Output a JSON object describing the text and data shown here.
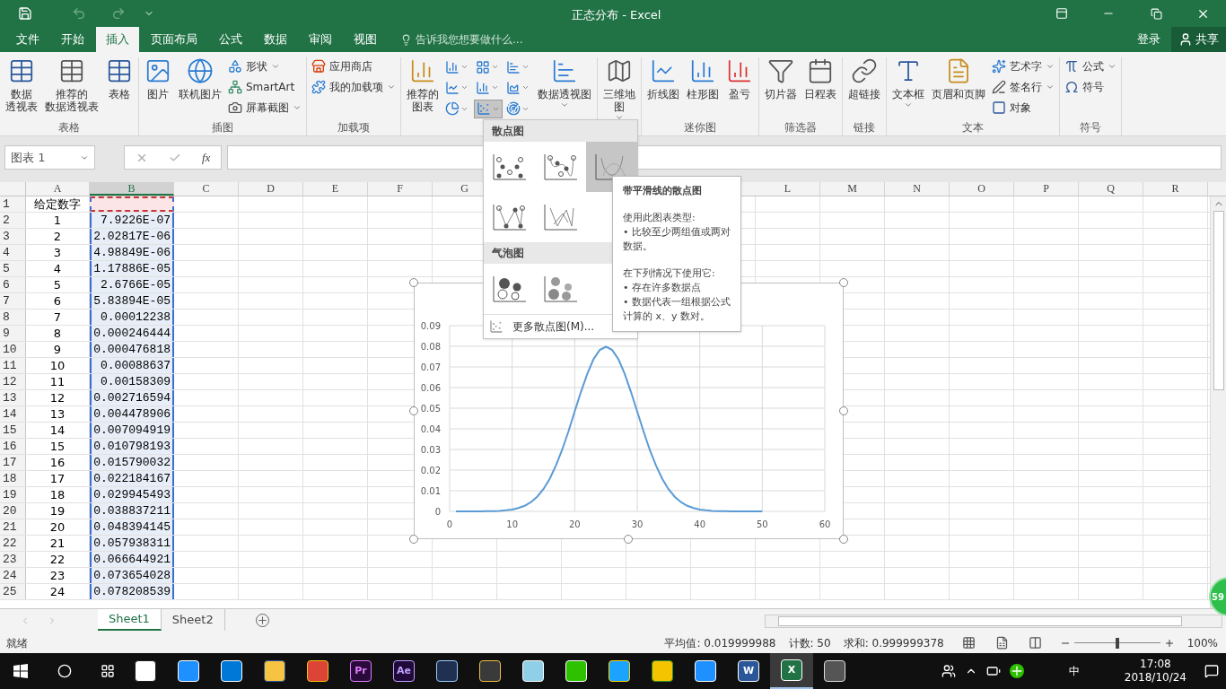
{
  "window": {
    "title": "正态分布 - Excel"
  },
  "tabs": [
    {
      "label": "文件",
      "selected": false
    },
    {
      "label": "开始",
      "selected": false
    },
    {
      "label": "插入",
      "selected": true
    },
    {
      "label": "页面布局",
      "selected": false
    },
    {
      "label": "公式",
      "selected": false
    },
    {
      "label": "数据",
      "selected": false
    },
    {
      "label": "审阅",
      "selected": false
    },
    {
      "label": "视图",
      "selected": false
    }
  ],
  "tell_me": {
    "placeholder": "告诉我您想要做什么..."
  },
  "account": {
    "sign_in": "登录",
    "share": "共享"
  },
  "ribbon": {
    "groups": [
      {
        "label": "表格",
        "items": [
          {
            "kind": "large",
            "lines": [
              "数据",
              "透视表"
            ],
            "dropdown": false
          },
          {
            "kind": "large",
            "lines": [
              "推荐的",
              "数据透视表"
            ],
            "dropdown": false
          },
          {
            "kind": "large",
            "lines": [
              "表格"
            ],
            "dropdown": false
          }
        ]
      },
      {
        "label": "插图",
        "items": [
          {
            "kind": "large",
            "lines": [
              "图片"
            ],
            "dropdown": false
          },
          {
            "kind": "large",
            "lines": [
              "联机图片"
            ],
            "dropdown": false
          },
          {
            "kind": "stack",
            "items": [
              {
                "label": "形状",
                "dropdown": true
              },
              {
                "label": "SmartArt",
                "dropdown": false
              },
              {
                "label": "屏幕截图",
                "dropdown": true
              }
            ]
          }
        ]
      },
      {
        "label": "加载项",
        "items": [
          {
            "kind": "stack",
            "items": [
              {
                "label": "应用商店",
                "dropdown": false
              },
              {
                "label": "我的加载项",
                "dropdown": true
              }
            ]
          }
        ]
      },
      {
        "items": [
          {
            "kind": "large",
            "lines": [
              "推荐的",
              "图表"
            ],
            "dropdown": false
          },
          {
            "kind": "grid",
            "items": [
              {
                "selected": false
              },
              {
                "selected": false
              },
              {
                "selected": false
              },
              {
                "selected": false
              },
              {
                "selected": false
              },
              {
                "selected": false
              },
              {
                "selected": false
              },
              {
                "selected": true
              },
              {
                "selected": false
              }
            ]
          },
          {
            "kind": "large",
            "lines": [
              "数据透视图"
            ],
            "dropdown": true
          }
        ]
      },
      {
        "items": [
          {
            "kind": "large",
            "lines": [
              "三维地",
              "图"
            ],
            "dropdown": true
          }
        ]
      },
      {
        "label": "迷你图",
        "items": [
          {
            "kind": "large",
            "lines": [
              "折线图"
            ],
            "dropdown": false
          },
          {
            "kind": "large",
            "lines": [
              "柱形图"
            ],
            "dropdown": false
          },
          {
            "kind": "large",
            "lines": [
              "盈亏"
            ],
            "dropdown": false
          }
        ]
      },
      {
        "label": "筛选器",
        "items": [
          {
            "kind": "large",
            "lines": [
              "切片器"
            ],
            "dropdown": false
          },
          {
            "kind": "large",
            "lines": [
              "日程表"
            ],
            "dropdown": false
          }
        ]
      },
      {
        "label": "链接",
        "items": [
          {
            "kind": "large",
            "lines": [
              "超链接"
            ],
            "dropdown": false
          }
        ]
      },
      {
        "label": "文本",
        "items": [
          {
            "kind": "large",
            "lines": [
              "文本框"
            ],
            "dropdown": true
          },
          {
            "kind": "large",
            "lines": [
              "页眉和页脚"
            ],
            "dropdown": false
          },
          {
            "kind": "stack",
            "items": [
              {
                "label": "艺术字",
                "dropdown": true
              },
              {
                "label": "签名行",
                "dropdown": true
              },
              {
                "label": "对象",
                "dropdown": false
              }
            ]
          }
        ]
      },
      {
        "label": "符号",
        "items": [
          {
            "kind": "stack",
            "items": [
              {
                "label": "公式",
                "dropdown": true
              },
              {
                "label": "符号",
                "dropdown": false
              }
            ]
          }
        ]
      }
    ]
  },
  "formula_bar": {
    "name_box": "图表 1",
    "fx": "fx"
  },
  "sheet": {
    "columns": [
      {
        "label": "A",
        "selected": false
      },
      {
        "label": "B",
        "selected": true
      },
      {
        "label": "C",
        "selected": false
      },
      {
        "label": "D",
        "selected": false
      },
      {
        "label": "E",
        "selected": false
      },
      {
        "label": "F",
        "selected": false
      },
      {
        "label": "G",
        "selected": false
      }
    ],
    "columns_right": [
      {
        "label": "L",
        "selected": false
      },
      {
        "label": "M",
        "selected": false
      },
      {
        "label": "N",
        "selected": false
      },
      {
        "label": "O",
        "selected": false
      },
      {
        "label": "P",
        "selected": false
      },
      {
        "label": "Q",
        "selected": false
      },
      {
        "label": "R",
        "selected": false
      }
    ],
    "rows": [
      {
        "number": "1",
        "a": "给定数字",
        "referenced": true
      },
      {
        "number": "2",
        "a": "1",
        "b": "7.9226E-07",
        "referenced": false
      },
      {
        "number": "3",
        "a": "2",
        "b": "2.02817E-06",
        "referenced": false
      },
      {
        "number": "4",
        "a": "3",
        "b": "4.98849E-06",
        "referenced": false
      },
      {
        "number": "5",
        "a": "4",
        "b": "1.17886E-05",
        "referenced": false
      },
      {
        "number": "6",
        "a": "5",
        "b": "2.6766E-05",
        "referenced": false
      },
      {
        "number": "7",
        "a": "6",
        "b": "5.83894E-05",
        "referenced": false
      },
      {
        "number": "8",
        "a": "7",
        "b": "0.00012238",
        "referenced": false
      },
      {
        "number": "9",
        "a": "8",
        "b": "0.000246444",
        "referenced": false
      },
      {
        "number": "10",
        "a": "9",
        "b": "0.000476818",
        "referenced": false
      },
      {
        "number": "11",
        "a": "10",
        "b": "0.00088637",
        "referenced": false
      },
      {
        "number": "12",
        "a": "11",
        "b": "0.00158309",
        "referenced": false
      },
      {
        "number": "13",
        "a": "12",
        "b": "0.002716594",
        "referenced": false
      },
      {
        "number": "14",
        "a": "13",
        "b": "0.004478906",
        "referenced": false
      },
      {
        "number": "15",
        "a": "14",
        "b": "0.007094919",
        "referenced": false
      },
      {
        "number": "16",
        "a": "15",
        "b": "0.010798193",
        "referenced": false
      },
      {
        "number": "17",
        "a": "16",
        "b": "0.015790032",
        "referenced": false
      },
      {
        "number": "18",
        "a": "17",
        "b": "0.022184167",
        "referenced": false
      },
      {
        "number": "19",
        "a": "18",
        "b": "0.029945493",
        "referenced": false
      },
      {
        "number": "20",
        "a": "19",
        "b": "0.038837211",
        "referenced": false
      },
      {
        "number": "21",
        "a": "20",
        "b": "0.048394145",
        "referenced": false
      },
      {
        "number": "22",
        "a": "21",
        "b": "0.057938311",
        "referenced": false
      },
      {
        "number": "23",
        "a": "22",
        "b": "0.066644921",
        "referenced": false
      },
      {
        "number": "24",
        "a": "23",
        "b": "0.073654028",
        "referenced": false
      },
      {
        "number": "25",
        "a": "24",
        "b": "0.078208539",
        "referenced": false
      }
    ]
  },
  "chart": {
    "chart_data": {
      "type": "line",
      "grid": true,
      "x": [
        1,
        2,
        3,
        4,
        5,
        6,
        7,
        8,
        9,
        10,
        11,
        12,
        13,
        14,
        15,
        16,
        17,
        18,
        19,
        20,
        21,
        22,
        23,
        24,
        25,
        26,
        27,
        28,
        29,
        30,
        31,
        32,
        33,
        34,
        35,
        36,
        37,
        38,
        39,
        40,
        41,
        42,
        43,
        44,
        45,
        46,
        47,
        48,
        49,
        50
      ],
      "series": [
        {
          "color": "#5b9bd5",
          "values": [
            0,
            0,
            0,
            0,
            0,
            0.0001,
            0.0001,
            0.0002,
            0.0005,
            0.0009,
            0.0016,
            0.0027,
            0.0045,
            0.0071,
            0.0108,
            0.0158,
            0.0222,
            0.0299,
            0.0388,
            0.0484,
            0.0579,
            0.0666,
            0.0737,
            0.0782,
            0.0798,
            0.0782,
            0.0737,
            0.0666,
            0.0579,
            0.0484,
            0.0388,
            0.0299,
            0.0222,
            0.0158,
            0.0108,
            0.0071,
            0.0045,
            0.0027,
            0.0016,
            0.0009,
            0.0005,
            0.0002,
            0.0001,
            0.0001,
            0,
            0,
            0,
            0,
            0,
            0
          ]
        }
      ],
      "xlim": [
        0,
        60
      ],
      "ylim": [
        0,
        0.09
      ],
      "xticks": [
        0,
        10,
        20,
        30,
        40,
        50,
        60
      ],
      "yticks": [
        {
          "value": 0,
          "label": "0"
        },
        {
          "value": 0.01,
          "label": "0.01"
        },
        {
          "value": 0.02,
          "label": "0.02"
        },
        {
          "value": 0.03,
          "label": "0.03"
        },
        {
          "value": 0.04,
          "label": "0.04"
        },
        {
          "value": 0.05,
          "label": "0.05"
        },
        {
          "value": 0.06,
          "label": "0.06"
        },
        {
          "value": 0.07,
          "label": "0.07"
        },
        {
          "value": 0.08,
          "label": "0.08"
        },
        {
          "value": 0.09,
          "label": "0.09"
        }
      ]
    }
  },
  "scatter_menu": {
    "sections": [
      {
        "title": "散点图",
        "options": [
          {
            "kind": "markers",
            "highlighted": false
          },
          {
            "kind": "smooth-markers",
            "highlighted": false
          },
          {
            "kind": "smooth",
            "highlighted": true
          },
          {
            "kind": "straight-markers",
            "highlighted": false
          },
          {
            "kind": "straight",
            "highlighted": false
          }
        ]
      },
      {
        "title": "气泡图",
        "options": [
          {
            "kind": "bubble",
            "highlighted": false
          },
          {
            "kind": "bubble-3d",
            "highlighted": false
          }
        ]
      }
    ],
    "more": "更多散点图(M)..."
  },
  "tooltip": {
    "title": "带平滑线的散点图",
    "paragraphs": [
      [
        "使用此图表类型:",
        "• 比较至少两组值或两对数据。"
      ],
      [
        "在下列情况下使用它:",
        "• 存在许多数据点",
        "• 数据代表一组根据公式计算的 x、y 数对。"
      ]
    ]
  },
  "sheet_tabs": [
    {
      "label": "Sheet1",
      "selected": true
    },
    {
      "label": "Sheet2",
      "selected": false
    }
  ],
  "status_bar": {
    "ready": "就绪",
    "average": "平均值: 0.019999988",
    "count": "计数: 50",
    "sum": "求和: 0.999999378",
    "zoom": {
      "level": 0.5,
      "reading": "100%"
    }
  },
  "badge": "59",
  "taskbar": {
    "apps": [
      {
        "kind": "pinwheel",
        "selected": false
      },
      {
        "kind": "ie",
        "selected": false
      },
      {
        "kind": "edge",
        "selected": false
      },
      {
        "kind": "folder",
        "selected": false
      },
      {
        "kind": "chrome",
        "selected": false
      },
      {
        "kind": "premiere",
        "label": "Pr",
        "selected": false
      },
      {
        "kind": "aftereffects",
        "label": "Ae",
        "selected": false
      },
      {
        "kind": "network",
        "selected": false
      },
      {
        "kind": "tools",
        "selected": false
      },
      {
        "kind": "notes",
        "selected": false
      },
      {
        "kind": "chat",
        "selected": false
      },
      {
        "kind": "video",
        "selected": false
      },
      {
        "kind": "music",
        "selected": false
      },
      {
        "kind": "ie",
        "selected": false
      },
      {
        "kind": "word",
        "label": "W",
        "selected": false
      },
      {
        "kind": "excel",
        "label": "X",
        "selected": true
      },
      {
        "kind": "cat",
        "selected": false
      }
    ],
    "ime": "中",
    "time": "17:08",
    "date": "2018/10/24"
  }
}
